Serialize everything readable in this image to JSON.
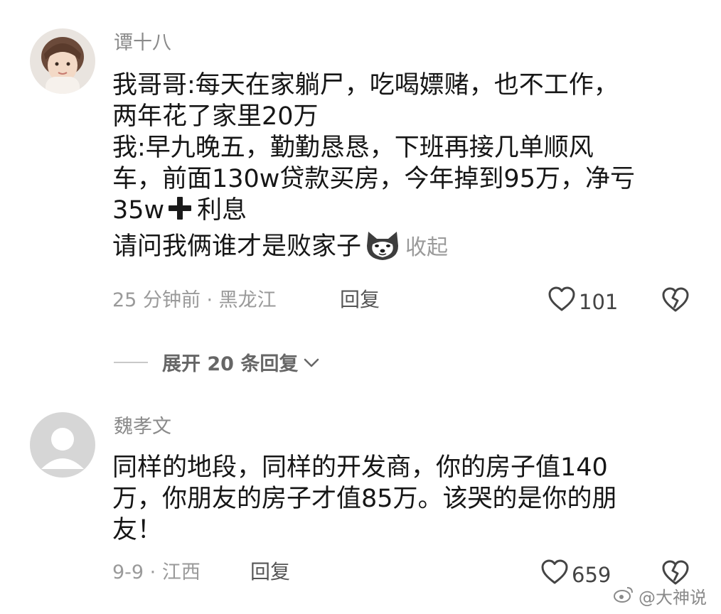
{
  "comments": [
    {
      "username": "谭十八",
      "lines": [
        "我哥哥:每天在家躺尸，吃喝嫖赌，也不工作，",
        "两年花了家里20万",
        "我:早九晚五，勤勤恳恳，下班再接几单顺风",
        "车，前面130w贷款买房，今年掉到95万，净亏",
        "35w",
        "利息",
        "请问我俩谁才是败家子"
      ],
      "collapse_label": "收起",
      "meta": "25 分钟前 · 黑龙江",
      "reply_label": "回复",
      "likes": "101"
    },
    {
      "username": "魏孝文",
      "lines": [
        "同样的地段，同样的开发商，你的房子值140",
        "万，你朋友的房子才值85万。该哭的是你的朋",
        "友！"
      ],
      "meta": "9-9 · 江西",
      "reply_label": "回复",
      "likes": "659"
    }
  ],
  "expand_replies_label": "展开 20 条回复",
  "watermark": "@大神说",
  "icons": [
    "heart-outline-icon",
    "broken-heart-icon",
    "chevron-down-icon",
    "plus-icon",
    "husky-sticker-icon",
    "weibo-logo-icon"
  ]
}
